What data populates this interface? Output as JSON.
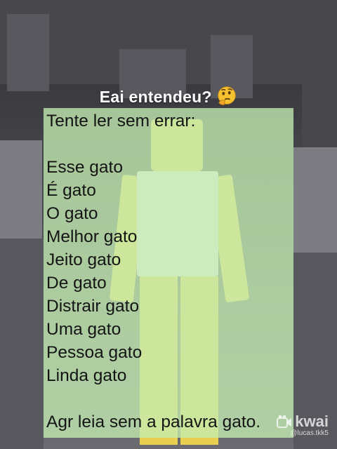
{
  "caption": {
    "text": "Eai entendeu?",
    "emoji": "thinking-face-icon"
  },
  "card": {
    "intro": "Tente ler sem errar:",
    "lines": [
      "Esse gato",
      "É gato",
      "O gato",
      "Melhor gato",
      "Jeito gato",
      "De gato",
      "Distrair gato",
      "Uma gato",
      "Pessoa gato",
      "Linda gato"
    ],
    "outro": "Agr leia sem a palavra gato."
  },
  "watermark": {
    "brand": "kwai",
    "handle": "@lucas.tkk5"
  },
  "colors": {
    "card_bg": "#c4ecb2",
    "character_yellow": "#e9cf4f",
    "caption_text": "#ffffff"
  }
}
